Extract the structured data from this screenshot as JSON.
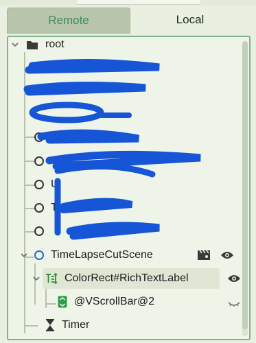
{
  "tabs": [
    {
      "label": "Remote",
      "active": true
    },
    {
      "label": "Local",
      "active": false
    }
  ],
  "tree": {
    "root_label": "root",
    "visible_nodes": [
      {
        "label": "U",
        "partial": true
      },
      {
        "label": "T",
        "partial": true
      },
      {
        "label": "TimeLapseCutScene"
      },
      {
        "label": "ColorRect#RichTextLabel",
        "selected": true
      },
      {
        "label": "@VScrollBar@2"
      },
      {
        "label": "Timer"
      }
    ]
  },
  "colors": {
    "accent": "#3e8a5c",
    "panel_border": "#7fb38f",
    "redaction": "#1555d6",
    "node_blue": "#2d62d6",
    "label_green": "#2e8b3a"
  },
  "icons": [
    "folder-icon",
    "chevron-down-icon",
    "chevron-right-icon",
    "circle-node-icon",
    "clapperboard-icon",
    "eye-icon",
    "rich-text-label-icon",
    "vscrollbar-icon",
    "hourglass-icon",
    "visibility-toggle-icon"
  ]
}
